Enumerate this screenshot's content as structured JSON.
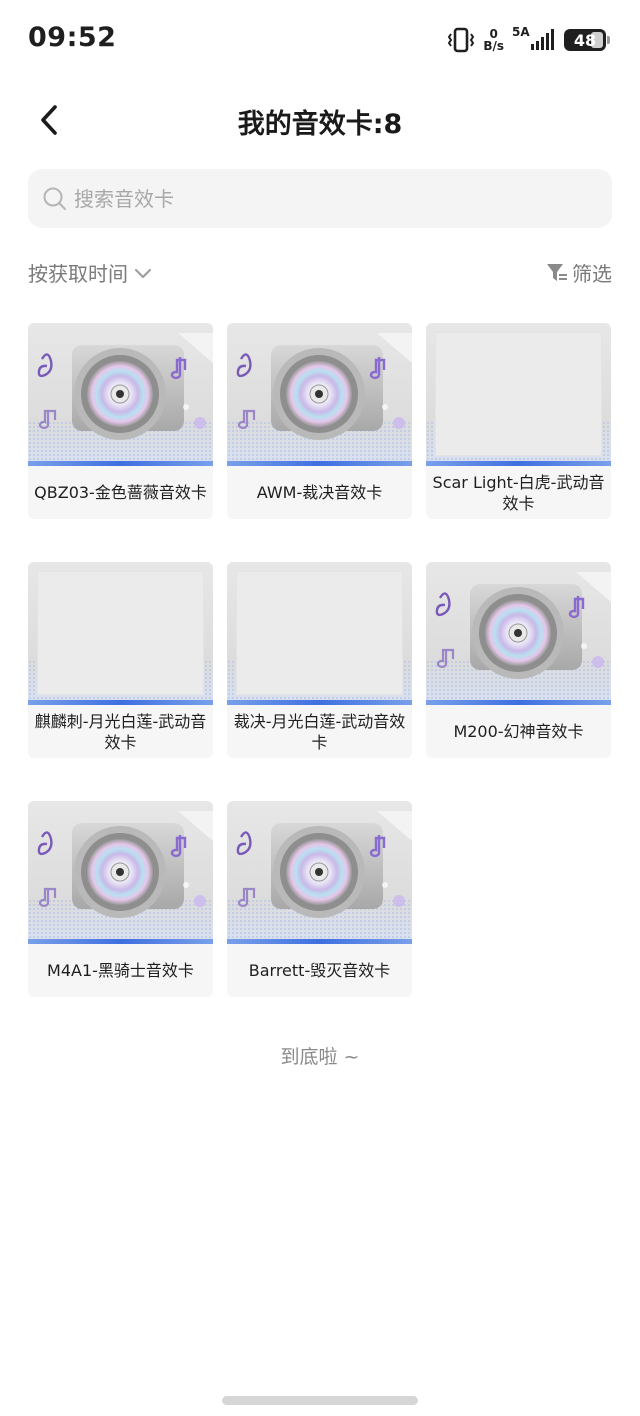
{
  "status_bar": {
    "time": "09:52",
    "net_speed_value": "0",
    "net_speed_unit": "B/s",
    "network_type": "5A",
    "battery": "48"
  },
  "header": {
    "title": "我的音效卡:8"
  },
  "search": {
    "placeholder": "搜索音效卡",
    "value": ""
  },
  "toolbar": {
    "sort_label": "按获取时间",
    "filter_label": "筛选"
  },
  "cards": [
    {
      "name": "QBZ03-金色蔷薇音效卡",
      "art": "disc"
    },
    {
      "name": "AWM-裁决音效卡",
      "art": "disc"
    },
    {
      "name": "Scar Light-白虎-武动音效卡",
      "art": "blank"
    },
    {
      "name": "麒麟刺-月光白莲-武动音效卡",
      "art": "blank"
    },
    {
      "name": "裁决-月光白莲-武动音效卡",
      "art": "blank"
    },
    {
      "name": "M200-幻神音效卡",
      "art": "disc"
    },
    {
      "name": "M4A1-黑骑士音效卡",
      "art": "disc"
    },
    {
      "name": "Barrett-毁灭音效卡",
      "art": "disc"
    }
  ],
  "footer": {
    "end_text": "到底啦 ~"
  },
  "colors": {
    "accent_bar": "#3e6fe0",
    "card_bg": "#f6f6f6",
    "search_bg": "#f4f4f4"
  }
}
